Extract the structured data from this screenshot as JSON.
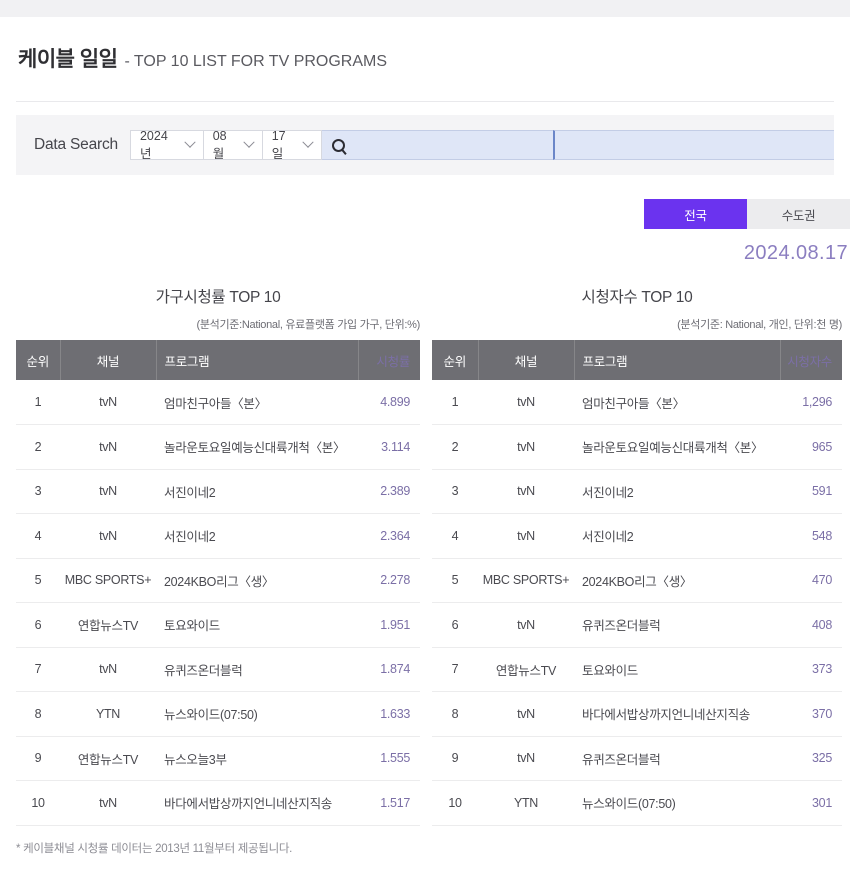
{
  "header": {
    "title_main": "케이블 일일",
    "title_sub": "- TOP 10 LIST FOR TV PROGRAMS"
  },
  "search": {
    "label": "Data Search",
    "year": "2024년",
    "month": "08월",
    "day": "17일",
    "search_icon": "search-icon",
    "query_value": "",
    "query_placeholder": ""
  },
  "region_toggle": {
    "options": [
      "전국",
      "수도권"
    ],
    "selected": "전국",
    "active_color": "#6b33ef",
    "inactive_color": "#ececee"
  },
  "date_display": "2024.08.17",
  "tables": [
    {
      "title": "가구시청률 TOP 10",
      "subtitle": "(분석기준:National, 유료플랫폼 가입 가구, 단위:%)",
      "columns": [
        "순위",
        "채널",
        "프로그램",
        "시청률"
      ],
      "rows": [
        {
          "rank": "1",
          "channel": "tvN",
          "program": "엄마친구아들〈본〉",
          "value": "4.899"
        },
        {
          "rank": "2",
          "channel": "tvN",
          "program": "놀라운토요일예능신대륙개척〈본〉",
          "value": "3.114"
        },
        {
          "rank": "3",
          "channel": "tvN",
          "program": "서진이네2",
          "value": "2.389"
        },
        {
          "rank": "4",
          "channel": "tvN",
          "program": "서진이네2",
          "value": "2.364"
        },
        {
          "rank": "5",
          "channel": "MBC SPORTS+",
          "program": "2024KBO리그〈생〉",
          "value": "2.278"
        },
        {
          "rank": "6",
          "channel": "연합뉴스TV",
          "program": "토요와이드",
          "value": "1.951"
        },
        {
          "rank": "7",
          "channel": "tvN",
          "program": "유퀴즈온더블럭",
          "value": "1.874"
        },
        {
          "rank": "8",
          "channel": "YTN",
          "program": "뉴스와이드(07:50)",
          "value": "1.633"
        },
        {
          "rank": "9",
          "channel": "연합뉴스TV",
          "program": "뉴스오늘3부",
          "value": "1.555"
        },
        {
          "rank": "10",
          "channel": "tvN",
          "program": "바다에서밥상까지언니네산지직송",
          "value": "1.517"
        }
      ]
    },
    {
      "title": "시청자수 TOP 10",
      "subtitle": "(분석기준: National, 개인, 단위:천 명)",
      "columns": [
        "순위",
        "채널",
        "프로그램",
        "시청자수"
      ],
      "rows": [
        {
          "rank": "1",
          "channel": "tvN",
          "program": "엄마친구아들〈본〉",
          "value": "1,296"
        },
        {
          "rank": "2",
          "channel": "tvN",
          "program": "놀라운토요일예능신대륙개척〈본〉",
          "value": "965"
        },
        {
          "rank": "3",
          "channel": "tvN",
          "program": "서진이네2",
          "value": "591"
        },
        {
          "rank": "4",
          "channel": "tvN",
          "program": "서진이네2",
          "value": "548"
        },
        {
          "rank": "5",
          "channel": "MBC SPORTS+",
          "program": "2024KBO리그〈생〉",
          "value": "470"
        },
        {
          "rank": "6",
          "channel": "tvN",
          "program": "유퀴즈온더블럭",
          "value": "408"
        },
        {
          "rank": "7",
          "channel": "연합뉴스TV",
          "program": "토요와이드",
          "value": "373"
        },
        {
          "rank": "8",
          "channel": "tvN",
          "program": "바다에서밥상까지언니네산지직송",
          "value": "370"
        },
        {
          "rank": "9",
          "channel": "tvN",
          "program": "유퀴즈온더블럭",
          "value": "325"
        },
        {
          "rank": "10",
          "channel": "YTN",
          "program": "뉴스와이드(07:50)",
          "value": "301"
        }
      ]
    }
  ],
  "footnote": "* 케이블채널 시청률 데이터는 2013년 11월부터 제공됩니다."
}
